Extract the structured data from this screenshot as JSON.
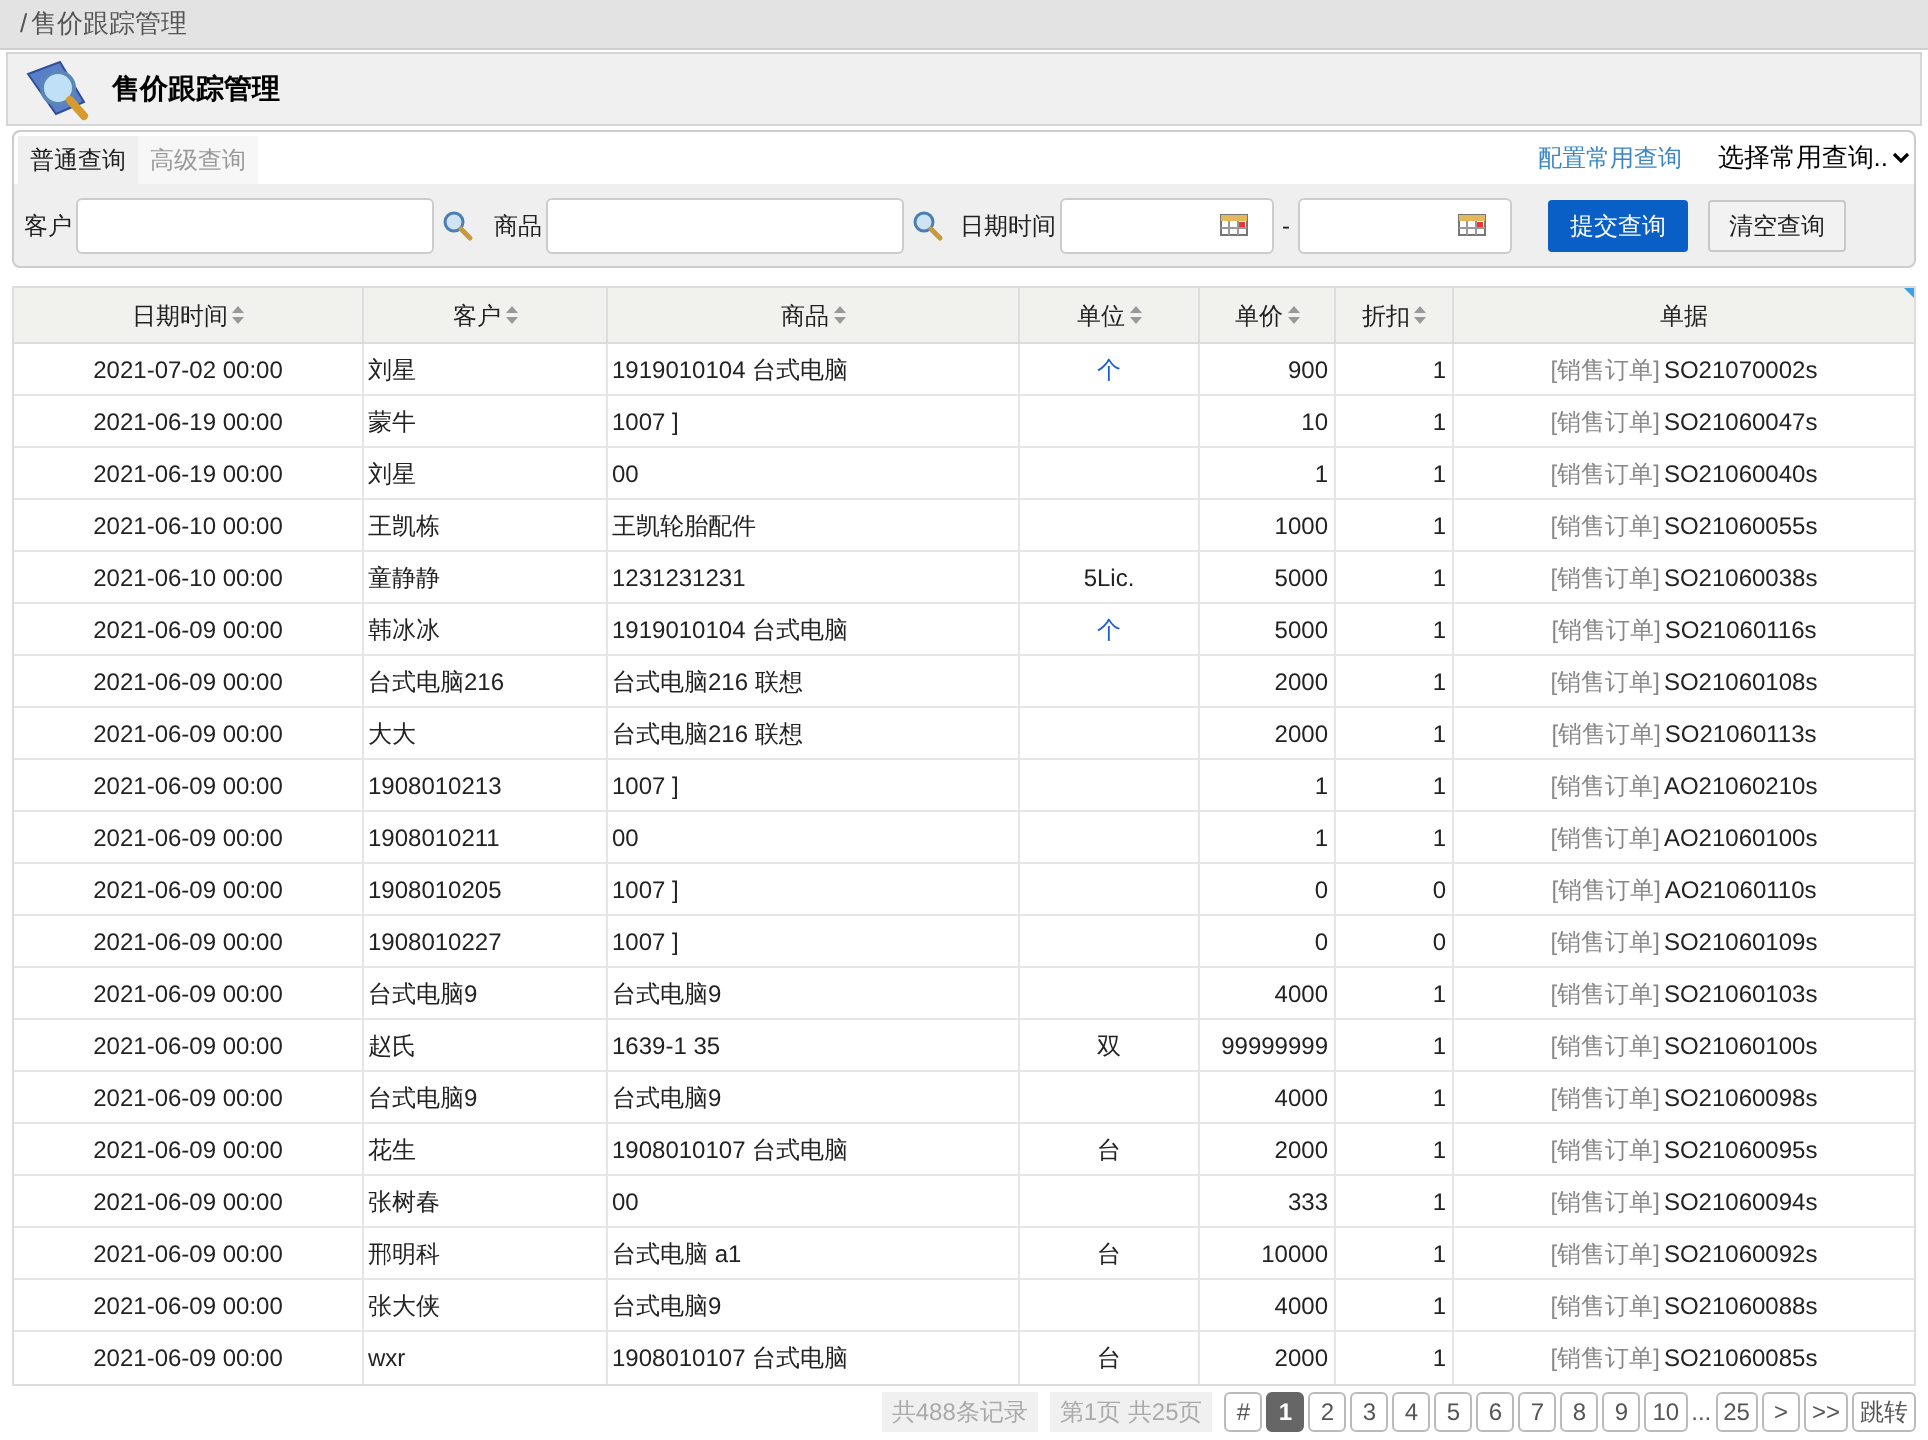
{
  "breadcrumb": {
    "separator": "/",
    "label": "售价跟踪管理"
  },
  "header": {
    "title": "售价跟踪管理"
  },
  "query": {
    "tabs": [
      {
        "label": "普通查询",
        "selected": true
      },
      {
        "label": "高级查询",
        "selected": false
      }
    ],
    "config_link": "配置常用查询",
    "saved_select": "选择常用查询..",
    "customer_label": "客户",
    "product_label": "商品",
    "date_label": "日期时间",
    "date_separator": "-",
    "submit": "提交查询",
    "clear": "清空查询"
  },
  "table": {
    "columns": [
      "日期时间",
      "客户",
      "商品",
      "单位",
      "单价",
      "折扣",
      "单据"
    ],
    "rows": [
      {
        "date": "2021-07-02 00:00",
        "customer": "刘星",
        "product": "1919010104 台式电脑",
        "unit": "个",
        "unit_link": true,
        "price": "900",
        "discount": "1",
        "doc_type": "[销售订单]",
        "doc_no": "SO21070002s"
      },
      {
        "date": "2021-06-19 00:00",
        "customer": "蒙牛",
        "product": "1007 ]",
        "price": "10",
        "discount": "1",
        "doc_type": "[销售订单]",
        "doc_no": "SO21060047s"
      },
      {
        "date": "2021-06-19 00:00",
        "customer": "刘星",
        "product": "00",
        "price": "1",
        "discount": "1",
        "doc_type": "[销售订单]",
        "doc_no": "SO21060040s"
      },
      {
        "date": "2021-06-10 00:00",
        "customer": "王凯栋",
        "product": "王凯轮胎配件",
        "price": "1000",
        "discount": "1",
        "doc_type": "[销售订单]",
        "doc_no": "SO21060055s"
      },
      {
        "date": "2021-06-10 00:00",
        "customer": "童静静",
        "product": "1231231231",
        "unit": "5Lic.",
        "unit_link": false,
        "price": "5000",
        "discount": "1",
        "doc_type": "[销售订单]",
        "doc_no": "SO21060038s"
      },
      {
        "date": "2021-06-09 00:00",
        "customer": "韩冰冰",
        "product": "1919010104 台式电脑",
        "unit": "个",
        "unit_link": true,
        "price": "5000",
        "discount": "1",
        "doc_type": "[销售订单]",
        "doc_no": "SO21060116s"
      },
      {
        "date": "2021-06-09 00:00",
        "customer": "台式电脑216",
        "product": "台式电脑216 联想",
        "price": "2000",
        "discount": "1",
        "doc_type": "[销售订单]",
        "doc_no": "SO21060108s"
      },
      {
        "date": "2021-06-09 00:00",
        "customer": "大大",
        "product": "台式电脑216 联想",
        "price": "2000",
        "discount": "1",
        "doc_type": "[销售订单]",
        "doc_no": "SO21060113s"
      },
      {
        "date": "2021-06-09 00:00",
        "customer": "1908010213",
        "product": "1007 ]",
        "price": "1",
        "discount": "1",
        "doc_type": "[销售订单]",
        "doc_no": "AO21060210s"
      },
      {
        "date": "2021-06-09 00:00",
        "customer": "1908010211",
        "product": "00",
        "price": "1",
        "discount": "1",
        "doc_type": "[销售订单]",
        "doc_no": "AO21060100s"
      },
      {
        "date": "2021-06-09 00:00",
        "customer": "1908010205",
        "product": "1007 ]",
        "price": "0",
        "discount": "0",
        "doc_type": "[销售订单]",
        "doc_no": "AO21060110s"
      },
      {
        "date": "2021-06-09 00:00",
        "customer": "1908010227",
        "product": "1007 ]",
        "price": "0",
        "discount": "0",
        "doc_type": "[销售订单]",
        "doc_no": "SO21060109s"
      },
      {
        "date": "2021-06-09 00:00",
        "customer": "台式电脑9",
        "product": "台式电脑9",
        "price": "4000",
        "discount": "1",
        "doc_type": "[销售订单]",
        "doc_no": "SO21060103s"
      },
      {
        "date": "2021-06-09 00:00",
        "customer": "赵氏",
        "product": "1639-1 35",
        "unit": "双",
        "unit_link": false,
        "price": "99999999",
        "discount": "1",
        "doc_type": "[销售订单]",
        "doc_no": "SO21060100s"
      },
      {
        "date": "2021-06-09 00:00",
        "customer": "台式电脑9",
        "product": "台式电脑9",
        "price": "4000",
        "discount": "1",
        "doc_type": "[销售订单]",
        "doc_no": "SO21060098s"
      },
      {
        "date": "2021-06-09 00:00",
        "customer": "花生",
        "product": "1908010107 台式电脑",
        "unit": "台",
        "unit_link": false,
        "price": "2000",
        "discount": "1",
        "doc_type": "[销售订单]",
        "doc_no": "SO21060095s"
      },
      {
        "date": "2021-06-09 00:00",
        "customer": "张树春",
        "product": "00",
        "price": "333",
        "discount": "1",
        "doc_type": "[销售订单]",
        "doc_no": "SO21060094s"
      },
      {
        "date": "2021-06-09 00:00",
        "customer": "邢明科",
        "product": "台式电脑 a1",
        "unit": "台",
        "unit_link": false,
        "price": "10000",
        "discount": "1",
        "doc_type": "[销售订单]",
        "doc_no": "SO21060092s"
      },
      {
        "date": "2021-06-09 00:00",
        "customer": "张大侠",
        "product": "台式电脑9",
        "price": "4000",
        "discount": "1",
        "doc_type": "[销售订单]",
        "doc_no": "SO21060088s"
      },
      {
        "date": "2021-06-09 00:00",
        "customer": "wxr",
        "product": "1908010107 台式电脑",
        "unit": "台",
        "unit_link": false,
        "price": "2000",
        "discount": "1",
        "doc_type": "[销售订单]",
        "doc_no": "SO21060085s"
      }
    ]
  },
  "pagination": {
    "total": "共488条记录",
    "page_info": "第1页 共25页",
    "pages": [
      {
        "label": "#",
        "selected": false
      },
      {
        "label": "1",
        "selected": true
      },
      {
        "label": "2",
        "selected": false
      },
      {
        "label": "3",
        "selected": false
      },
      {
        "label": "4",
        "selected": false
      },
      {
        "label": "5",
        "selected": false
      },
      {
        "label": "6",
        "selected": false
      },
      {
        "label": "7",
        "selected": false
      },
      {
        "label": "8",
        "selected": false
      },
      {
        "label": "9",
        "selected": false
      },
      {
        "label": "10",
        "selected": false
      }
    ],
    "ellipsis": "...",
    "after": [
      "25",
      ">",
      ">>",
      "跳转"
    ]
  }
}
